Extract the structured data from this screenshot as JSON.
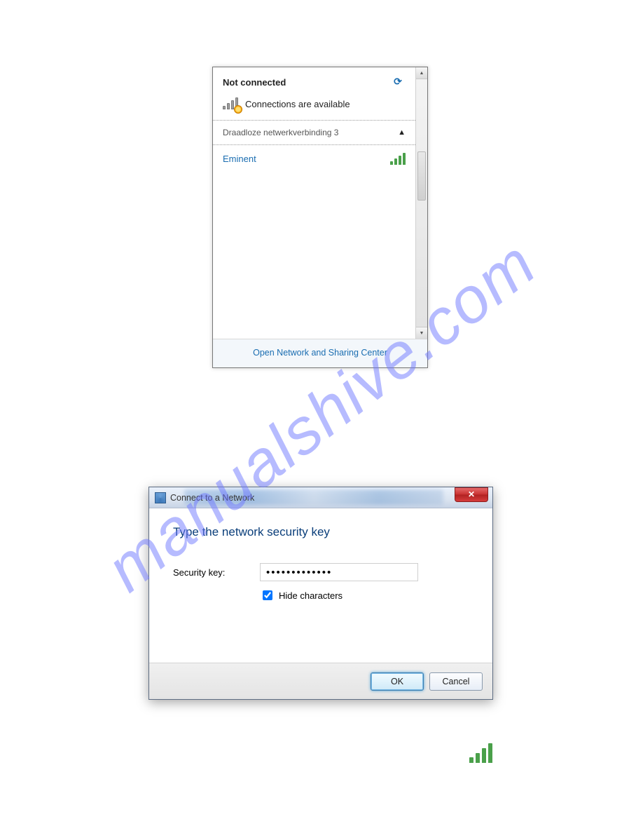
{
  "watermark": "manualshive.com",
  "flyout": {
    "status_title": "Not connected",
    "availability": "Connections are available",
    "adapter_name": "Draadloze netwerkverbinding 3",
    "network_name": "Eminent",
    "footer_link": "Open Network and Sharing Center"
  },
  "dialog": {
    "title": "Connect to a Network",
    "headline": "Type the network security key",
    "key_label": "Security key:",
    "key_value": "●●●●●●●●●●●●●",
    "hide_label": "Hide characters",
    "ok_label": "OK",
    "cancel_label": "Cancel"
  }
}
